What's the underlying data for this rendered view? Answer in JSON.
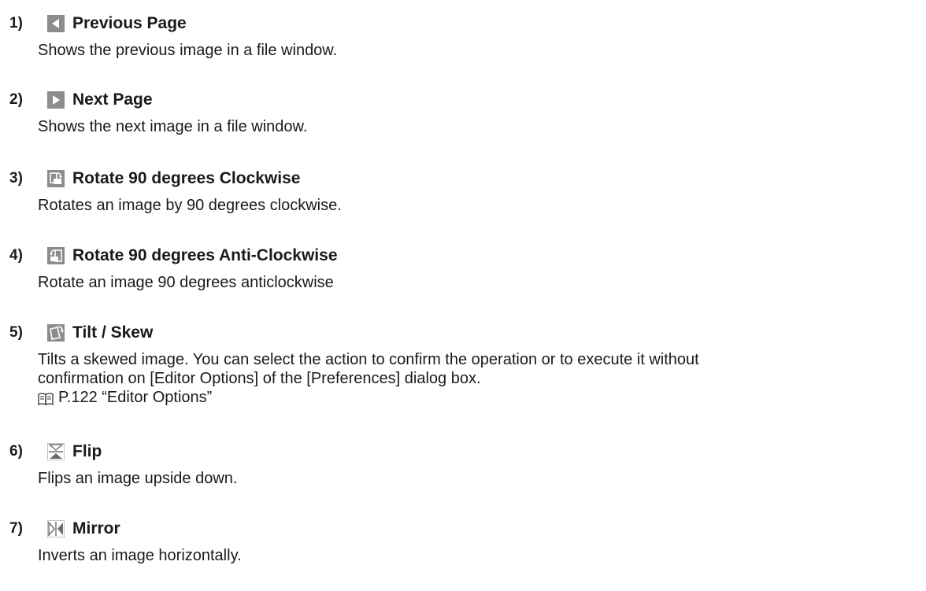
{
  "items": [
    {
      "number": "1)",
      "icon": "previous-page-icon",
      "title": "Previous Page",
      "description": "Shows the previous image in a file window."
    },
    {
      "number": "2)",
      "icon": "next-page-icon",
      "title": "Next Page",
      "description": "Shows the next image in a file window."
    },
    {
      "number": "3)",
      "icon": "rotate-clockwise-icon",
      "title": "Rotate 90 degrees Clockwise",
      "description": "Rotates an image by 90 degrees clockwise."
    },
    {
      "number": "4)",
      "icon": "rotate-anticlockwise-icon",
      "title": "Rotate 90 degrees Anti-Clockwise",
      "description": "Rotate an image 90 degrees anticlockwise"
    },
    {
      "number": "5)",
      "icon": "tilt-skew-icon",
      "title": "Tilt / Skew",
      "description_line1": "Tilts a skewed image. You can select the action to confirm the operation or to execute it without",
      "description_line2": "confirmation on [Editor Options] of the [Preferences] dialog box.",
      "reference_icon": "book-icon",
      "reference": "P.122 “Editor Options”"
    },
    {
      "number": "6)",
      "icon": "flip-icon",
      "title": "Flip",
      "description": "Flips an image upside down."
    },
    {
      "number": "7)",
      "icon": "mirror-icon",
      "title": "Mirror",
      "description": "Inverts an image horizontally."
    }
  ]
}
